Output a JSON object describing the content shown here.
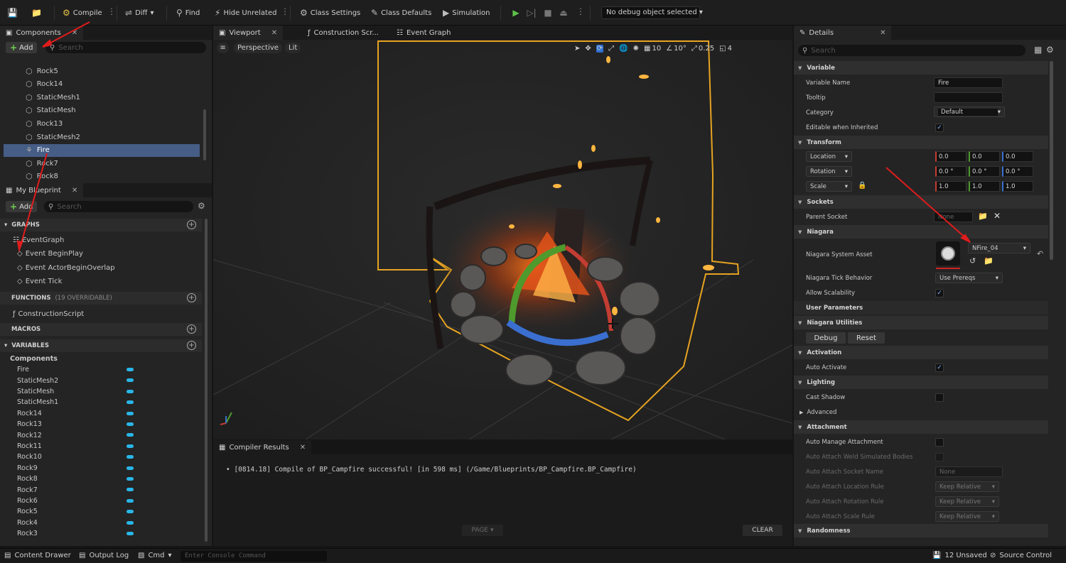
{
  "toolbar": {
    "compile": "Compile",
    "diff": "Diff",
    "find": "Find",
    "hide_unrelated": "Hide Unrelated",
    "class_settings": "Class Settings",
    "class_defaults": "Class Defaults",
    "simulation": "Simulation",
    "debug_object": "No debug object selected"
  },
  "components_panel": {
    "tab": "Components",
    "add": "Add",
    "search_placeholder": "Search",
    "items": [
      "Rock5",
      "Rock14",
      "StaticMesh1",
      "StaticMesh",
      "Rock13",
      "StaticMesh2",
      "Fire",
      "Rock7",
      "Rock8"
    ],
    "selected": "Fire"
  },
  "my_blueprint": {
    "tab": "My Blueprint",
    "add": "Add",
    "search_placeholder": "Search",
    "graphs_header": "GRAPHS",
    "event_graph": "EventGraph",
    "events": [
      "Event BeginPlay",
      "Event ActorBeginOverlap",
      "Event Tick"
    ],
    "functions_header": "FUNCTIONS",
    "functions_count": "(19 OVERRIDABLE)",
    "construction_script": "ConstructionScript",
    "macros_header": "MACROS",
    "variables_header": "VARIABLES",
    "components_group": "Components",
    "variables": [
      "Fire",
      "StaticMesh2",
      "StaticMesh",
      "StaticMesh1",
      "Rock14",
      "Rock13",
      "Rock12",
      "Rock11",
      "Rock10",
      "Rock9",
      "Rock8",
      "Rock7",
      "Rock6",
      "Rock5",
      "Rock4",
      "Rock3"
    ]
  },
  "editor_tabs": {
    "viewport": "Viewport",
    "construction": "Construction Scr...",
    "event_graph": "Event Graph"
  },
  "viewport": {
    "perspective": "Perspective",
    "lit": "Lit",
    "grid": "10",
    "angle": "10°",
    "scale": "0.25",
    "camera_speed": "4"
  },
  "compiler": {
    "tab": "Compiler Results",
    "message": "[0814.18] Compile of BP_Campfire successful! [in 598 ms] (/Game/Blueprints/BP_Campfire.BP_Campfire)",
    "page": "PAGE",
    "clear": "CLEAR"
  },
  "details": {
    "tab": "Details",
    "search_placeholder": "Search",
    "variable_header": "Variable",
    "variable_name_label": "Variable Name",
    "variable_name": "Fire",
    "tooltip_label": "Tooltip",
    "category_label": "Category",
    "category": "Default",
    "editable_label": "Editable when Inherited",
    "transform_header": "Transform",
    "location": "Location",
    "rotation": "Rotation",
    "scale": "Scale",
    "loc": [
      "0.0",
      "0.0",
      "0.0"
    ],
    "rot": [
      "0.0 °",
      "0.0 °",
      "0.0 °"
    ],
    "scl": [
      "1.0",
      "1.0",
      "1.0"
    ],
    "sockets_header": "Sockets",
    "parent_socket_label": "Parent Socket",
    "parent_socket": "None",
    "niagara_header": "Niagara",
    "system_asset_label": "Niagara System Asset",
    "system_asset": "NFire_04",
    "tick_behavior_label": "Niagara Tick Behavior",
    "tick_behavior": "Use Prereqs",
    "allow_scalability_label": "Allow Scalability",
    "user_params": "User Parameters",
    "utilities_header": "Niagara Utilities",
    "debug": "Debug",
    "reset": "Reset",
    "activation_header": "Activation",
    "auto_activate_label": "Auto Activate",
    "lighting_header": "Lighting",
    "cast_shadow_label": "Cast Shadow",
    "advanced": "Advanced",
    "attachment_header": "Attachment",
    "auto_manage_label": "Auto Manage Attachment",
    "weld_label": "Auto Attach Weld Simulated Bodies",
    "socket_name_label": "Auto Attach Socket Name",
    "socket_name": "None",
    "loc_rule_label": "Auto Attach Location Rule",
    "rot_rule_label": "Auto Attach Rotation Rule",
    "scale_rule_label": "Auto Attach Scale Rule",
    "keep_relative": "Keep Relative",
    "randomness_header": "Randomness"
  },
  "statusbar": {
    "content_drawer": "Content Drawer",
    "output_log": "Output Log",
    "cmd": "Cmd",
    "console_placeholder": "Enter Console Command",
    "unsaved": "12 Unsaved",
    "source_control": "Source Control"
  }
}
